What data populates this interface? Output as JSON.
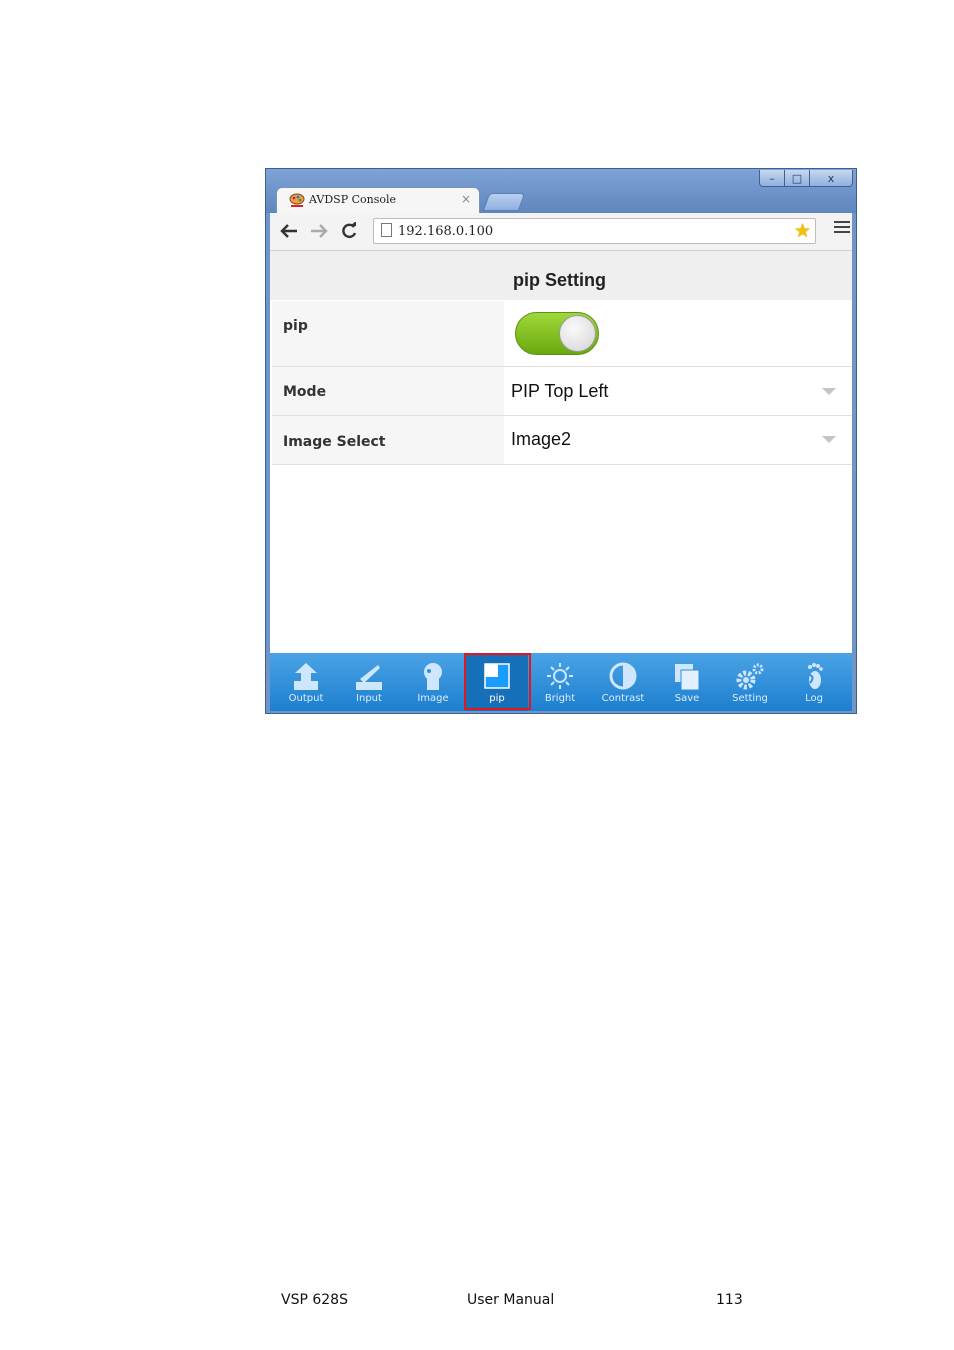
{
  "browser": {
    "tab_title": "AVDSP Console",
    "tab_close": "×",
    "url": "192.168.0.100",
    "window_controls": {
      "minimize": "–",
      "maximize": "□",
      "close": "x"
    }
  },
  "page": {
    "title": "pip Setting",
    "rows": [
      {
        "label": "pip",
        "type": "toggle",
        "state": "on"
      },
      {
        "label": "Mode",
        "type": "select",
        "value": "PIP Top Left"
      },
      {
        "label": "Image Select",
        "type": "select",
        "value": "Image2"
      }
    ]
  },
  "bottom_nav": {
    "items": [
      {
        "label": "Output",
        "icon": "output-icon"
      },
      {
        "label": "Input",
        "icon": "input-icon"
      },
      {
        "label": "Image",
        "icon": "image-icon"
      },
      {
        "label": "pip",
        "icon": "pip-icon",
        "active": true
      },
      {
        "label": "Bright",
        "icon": "brightness-icon"
      },
      {
        "label": "Contrast",
        "icon": "contrast-icon"
      },
      {
        "label": "Save",
        "icon": "save-icon"
      },
      {
        "label": "Setting",
        "icon": "gear-icon"
      },
      {
        "label": "Log",
        "icon": "footprint-icon"
      }
    ]
  },
  "footer": {
    "product": "VSP 628S",
    "doc": "User Manual",
    "page_number": "113"
  },
  "colors": {
    "toggle_on": "#7ec11f",
    "nav_bar": "#2f8fd9",
    "highlight": "#e4161c"
  }
}
